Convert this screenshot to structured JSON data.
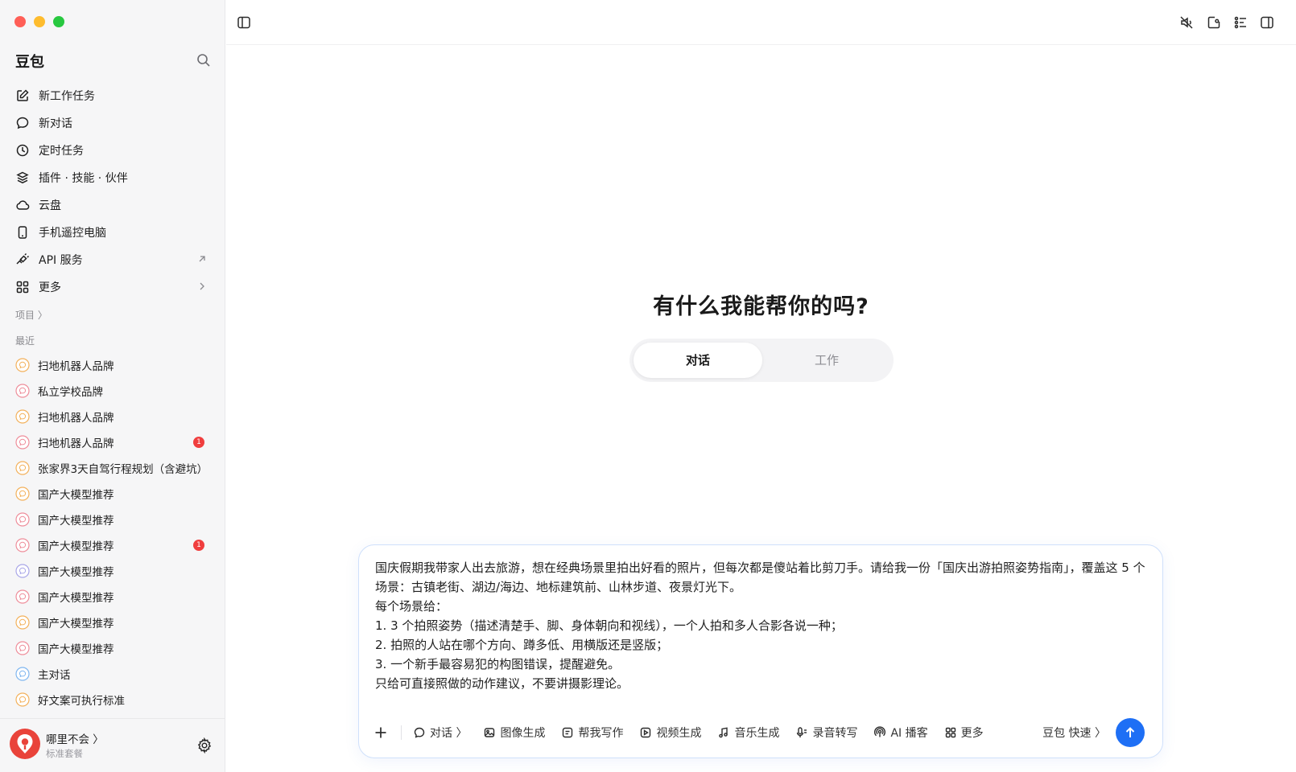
{
  "app": {
    "brand": "豆包"
  },
  "sidebar": {
    "menu": [
      {
        "label": "新工作任务",
        "icon": "edit-icon"
      },
      {
        "label": "新对话",
        "icon": "chat-bubble-icon"
      },
      {
        "label": "定时任务",
        "icon": "clock-icon"
      },
      {
        "label": "插件 · 技能 · 伙伴",
        "icon": "layers-icon"
      },
      {
        "label": "云盘",
        "icon": "cloud-icon"
      },
      {
        "label": "手机遥控电脑",
        "icon": "phone-icon"
      },
      {
        "label": "API 服务",
        "icon": "api-icon"
      },
      {
        "label": "更多",
        "icon": "grid-icon"
      }
    ],
    "projects_label": "项目 〉",
    "recent_label": "最近",
    "recent": [
      {
        "label": "扫地机器人品牌",
        "dot": "#f3b15b"
      },
      {
        "label": "私立学校品牌",
        "dot": "#ee8d9a"
      },
      {
        "label": "扫地机器人品牌",
        "dot": "#f3b15b"
      },
      {
        "label": "扫地机器人品牌",
        "dot": "#ee8d9a",
        "badge": "1"
      },
      {
        "label": "张家界3天自驾行程规划（含避坑）",
        "dot": "#f3b15b"
      },
      {
        "label": "国产大模型推荐",
        "dot": "#f3b15b"
      },
      {
        "label": "国产大模型推荐",
        "dot": "#ee8d9a"
      },
      {
        "label": "国产大模型推荐",
        "dot": "#ee8d9a",
        "badge": "1"
      },
      {
        "label": "国产大模型推荐",
        "dot": "#a9a6e8"
      },
      {
        "label": "国产大模型推荐",
        "dot": "#ee8d9a"
      },
      {
        "label": "国产大模型推荐",
        "dot": "#f3b15b"
      },
      {
        "label": "国产大模型推荐",
        "dot": "#ee8d9a"
      },
      {
        "label": "主对话",
        "dot": "#7fb6f0"
      },
      {
        "label": "好文案可执行标准",
        "dot": "#f3b15b"
      }
    ],
    "user": {
      "name": "哪里不会 〉",
      "plan": "标准套餐"
    }
  },
  "main": {
    "headline": "有什么我能帮你的吗?",
    "modes": {
      "active": "对话",
      "inactive": "工作"
    },
    "prompt_lines": [
      "国庆假期我带家人出去旅游，想在经典场景里拍出好看的照片，但每次都是傻站着比剪刀手。请给我一份「国庆出游拍照姿势指南」，覆盖这 5 个场景：古镇老街、湖边/海边、地标建筑前、山林步道、夜景灯光下。",
      "每个场景给：",
      "1. 3 个拍照姿势（描述清楚手、脚、身体朝向和视线），一个人拍和多人合影各说一种；",
      "2. 拍照的人站在哪个方向、蹲多低、用横版还是竖版；",
      "3. 一个新手最容易犯的构图错误，提醒避免。",
      "只给可直接照做的动作建议，不要讲摄影理论。"
    ],
    "tools": [
      {
        "label": "对话 〉",
        "icon": "chat-bubble-icon"
      },
      {
        "label": "图像生成",
        "icon": "image-icon"
      },
      {
        "label": "帮我写作",
        "icon": "write-icon"
      },
      {
        "label": "视频生成",
        "icon": "video-icon"
      },
      {
        "label": "音乐生成",
        "icon": "music-note-icon"
      },
      {
        "label": "录音转写",
        "icon": "microphone-icon"
      },
      {
        "label": "AI 播客",
        "icon": "podcast-icon"
      },
      {
        "label": "更多",
        "icon": "grid-icon"
      }
    ],
    "model": "豆包 快速 〉"
  },
  "colors": {
    "accent": "#1e6ff5",
    "badge": "#f03e3e",
    "sidebar_bg": "#f6f6f7"
  }
}
